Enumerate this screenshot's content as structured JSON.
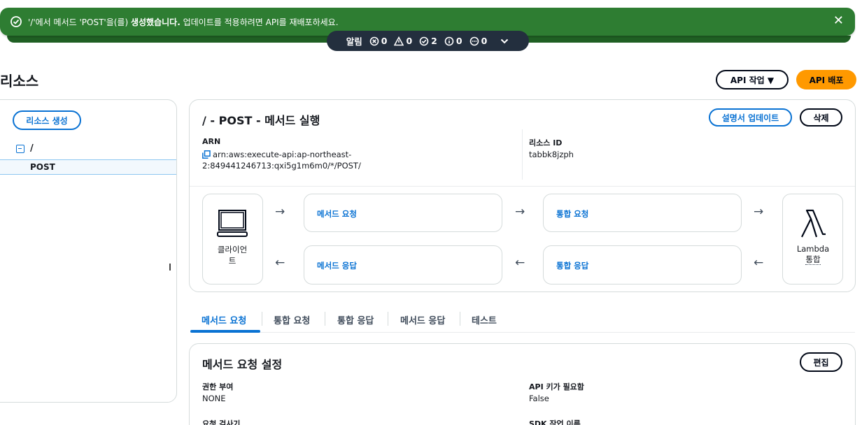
{
  "flash": {
    "message_prefix": "'/'에서 메서드 'POST'을(를) ",
    "message_bold": "생성했습니다.",
    "message_suffix": " 업데이트를 적용하려면 API를 재배포하세요.",
    "close_label": "✕"
  },
  "notifications": {
    "label": "알림",
    "error_count": "0",
    "warning_count": "0",
    "success_count": "2",
    "info_count": "0",
    "progress_count": "0"
  },
  "header": {
    "title": "리소스",
    "api_actions_label": "API 작업 ▼",
    "deploy_label": "API 배포"
  },
  "sidebar": {
    "create_resource_label": "리소스 생성",
    "root_label": "/",
    "selected_method": "POST"
  },
  "method_execution": {
    "title": "/ - POST - 메서드 실행",
    "update_docs_label": "설명서 업데이트",
    "delete_label": "삭제",
    "arn_label": "ARN",
    "arn_value_line1": "arn:aws:execute-api:ap-northeast-",
    "arn_value_line2": "2:849441246713:qxi5g1m6m0/*/POST/",
    "resource_id_label": "리소스 ID",
    "resource_id_value": "tabbk8jzph",
    "flow": {
      "client_label_line1": "클라이언",
      "client_label_line2": "트",
      "method_request": "메서드 요청",
      "integration_request": "통합 요청",
      "method_response": "메서드 응답",
      "integration_response": "통합 응답",
      "lambda_label": "Lambda",
      "integration_label": "통합"
    }
  },
  "tabs": [
    {
      "label": "메서드 요청",
      "active": true
    },
    {
      "label": "통합 요청",
      "active": false
    },
    {
      "label": "통합 응답",
      "active": false
    },
    {
      "label": "메서드 응답",
      "active": false
    },
    {
      "label": "테스트",
      "active": false
    }
  ],
  "settings": {
    "title": "메서드 요청 설정",
    "edit_label": "편집",
    "authorization_label": "권한 부여",
    "authorization_value": "NONE",
    "api_key_label": "API 키가 필요함",
    "api_key_value": "False",
    "validator_label": "요청 검사기",
    "sdk_label": "SDK 작업 이름"
  },
  "colors": {
    "success": "#2e7d32",
    "accent": "#0972d3",
    "primary_button": "#ff9900",
    "notification_bar": "#232f3e"
  }
}
